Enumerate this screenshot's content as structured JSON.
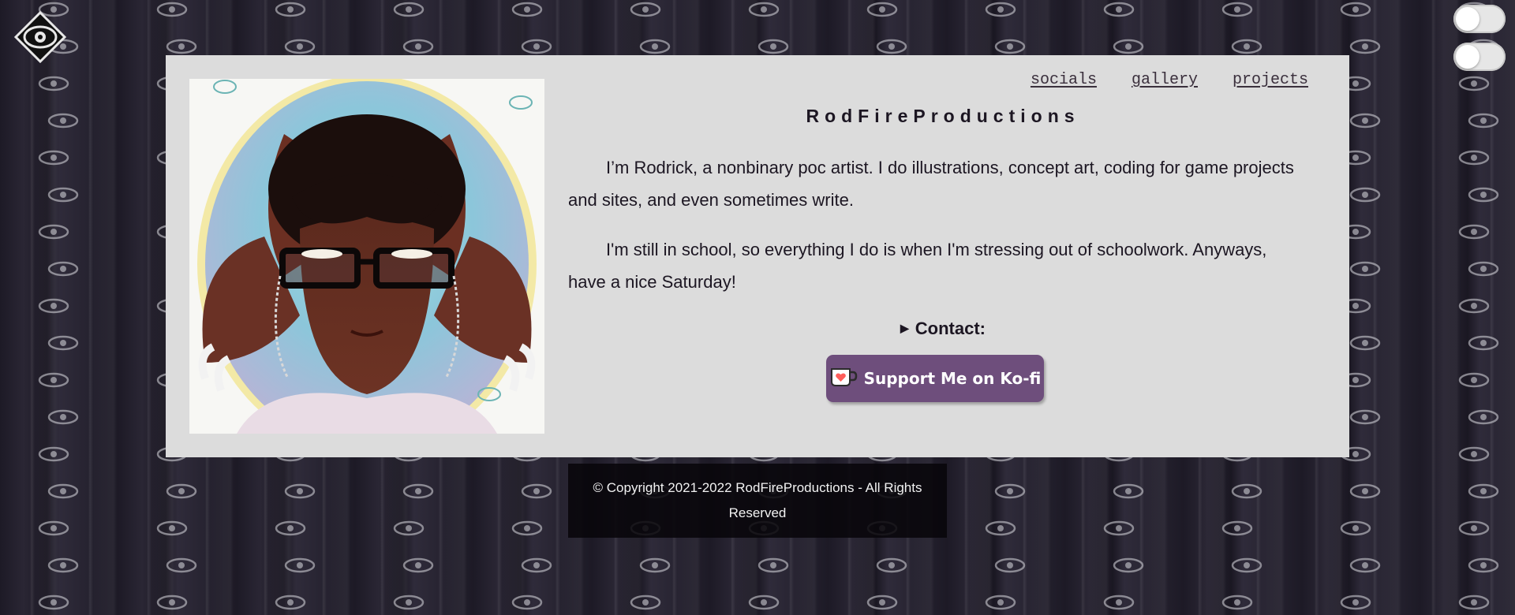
{
  "nav": {
    "items": [
      {
        "label": "socials"
      },
      {
        "label": "gallery"
      },
      {
        "label": "projects"
      }
    ]
  },
  "site": {
    "title": "RodFireProductions"
  },
  "about": {
    "paragraphs": [
      "I’m Rodrick, a nonbinary poc artist. I do illustrations, concept art, coding for game projects and sites, and even sometimes write.",
      "I'm still in school, so everything I do is when I'm stressing out of schoolwork. Anyways, have a nice Saturday!"
    ]
  },
  "contact": {
    "label": "Contact:"
  },
  "kofi": {
    "label": "Support Me on Ko-fi"
  },
  "footer": {
    "text": "© Copyright 2021-2022 RodFireProductions - All Rights Reserved"
  },
  "colors": {
    "card_bg": "#dcdcdc",
    "kofi_purple": "#6e4e7c",
    "text_dark": "#1c1622",
    "footer_bg": "#0a080c"
  },
  "icons": {
    "logo": "eye-logo-icon",
    "kofi_cup": "ko-fi-cup-icon",
    "contact_arrow": "disclosure-triangle-icon"
  }
}
